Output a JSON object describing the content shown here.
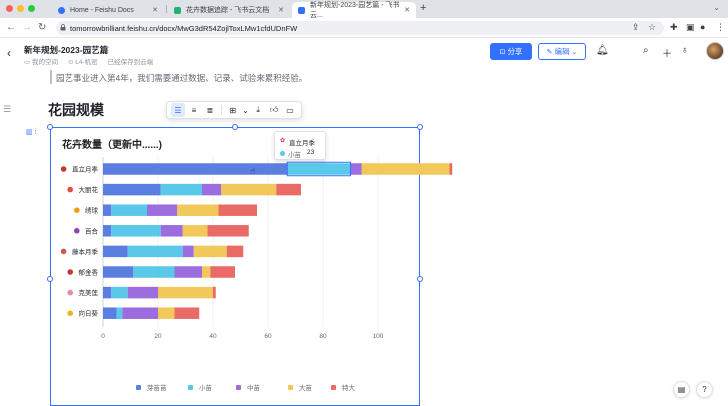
{
  "browser": {
    "tabs": [
      {
        "title": "Home - Feishu Docs",
        "fav_color": "#3370ff",
        "active": false
      },
      {
        "title": "花卉数据追踪 - 飞书云文档",
        "fav_color": "#23b26d",
        "active": false
      },
      {
        "title": "新年规划-2023-园艺篇 - 飞书云...",
        "fav_color": "#3370ff",
        "active": true
      }
    ],
    "new_tab": "+",
    "url": "tomorrowbrilliant.feishu.cn/docx/MwG3dR54ZojlToxLMw1cfdUDnFW"
  },
  "doc": {
    "title": "新年规划-2023-园艺篇",
    "meta": [
      "我的空间",
      "L4-机密",
      "已经保存到云端"
    ],
    "share_label": "分享",
    "edit_label": "编辑",
    "quote": "园艺事业进入第4年，我们需要通过数据、记录、试验来累积经验。",
    "heading": "花园规模"
  },
  "tooltip": {
    "title": "直立月季",
    "series": "小苗",
    "value": "23"
  },
  "chart_data": {
    "type": "bar",
    "orientation": "horizontal",
    "stacked": true,
    "title": "花卉数量（更新中......)",
    "categories": [
      "直立月季",
      "大丽花",
      "绣球",
      "百合",
      "藤本月季",
      "郁金香",
      "克美莲",
      "向日葵"
    ],
    "category_icons": [
      "rose",
      "dahlia",
      "hydrangea",
      "lily",
      "climbing-rose",
      "tulip",
      "clematis",
      "sunflower"
    ],
    "series": [
      {
        "name": "芽苗苗",
        "color": "#5b7fe0",
        "values": [
          67,
          21,
          3,
          3,
          9,
          11,
          3,
          5
        ]
      },
      {
        "name": "小苗",
        "color": "#5ac8e8",
        "values": [
          23,
          15,
          13,
          18,
          20,
          15,
          6,
          2
        ]
      },
      {
        "name": "中苗",
        "color": "#9b6ddf",
        "values": [
          4,
          7,
          11,
          8,
          4,
          10,
          11,
          13
        ]
      },
      {
        "name": "大苗",
        "color": "#f2c85b",
        "values": [
          32,
          20,
          15,
          9,
          12,
          3,
          20,
          6
        ]
      },
      {
        "name": "特大",
        "color": "#ea6b66",
        "values": [
          1,
          9,
          14,
          15,
          6,
          9,
          1,
          9
        ]
      }
    ],
    "xticks": [
      0,
      20,
      40,
      60,
      80,
      100
    ],
    "xlim": [
      0,
      100
    ],
    "grid": true,
    "legend_position": "bottom"
  }
}
